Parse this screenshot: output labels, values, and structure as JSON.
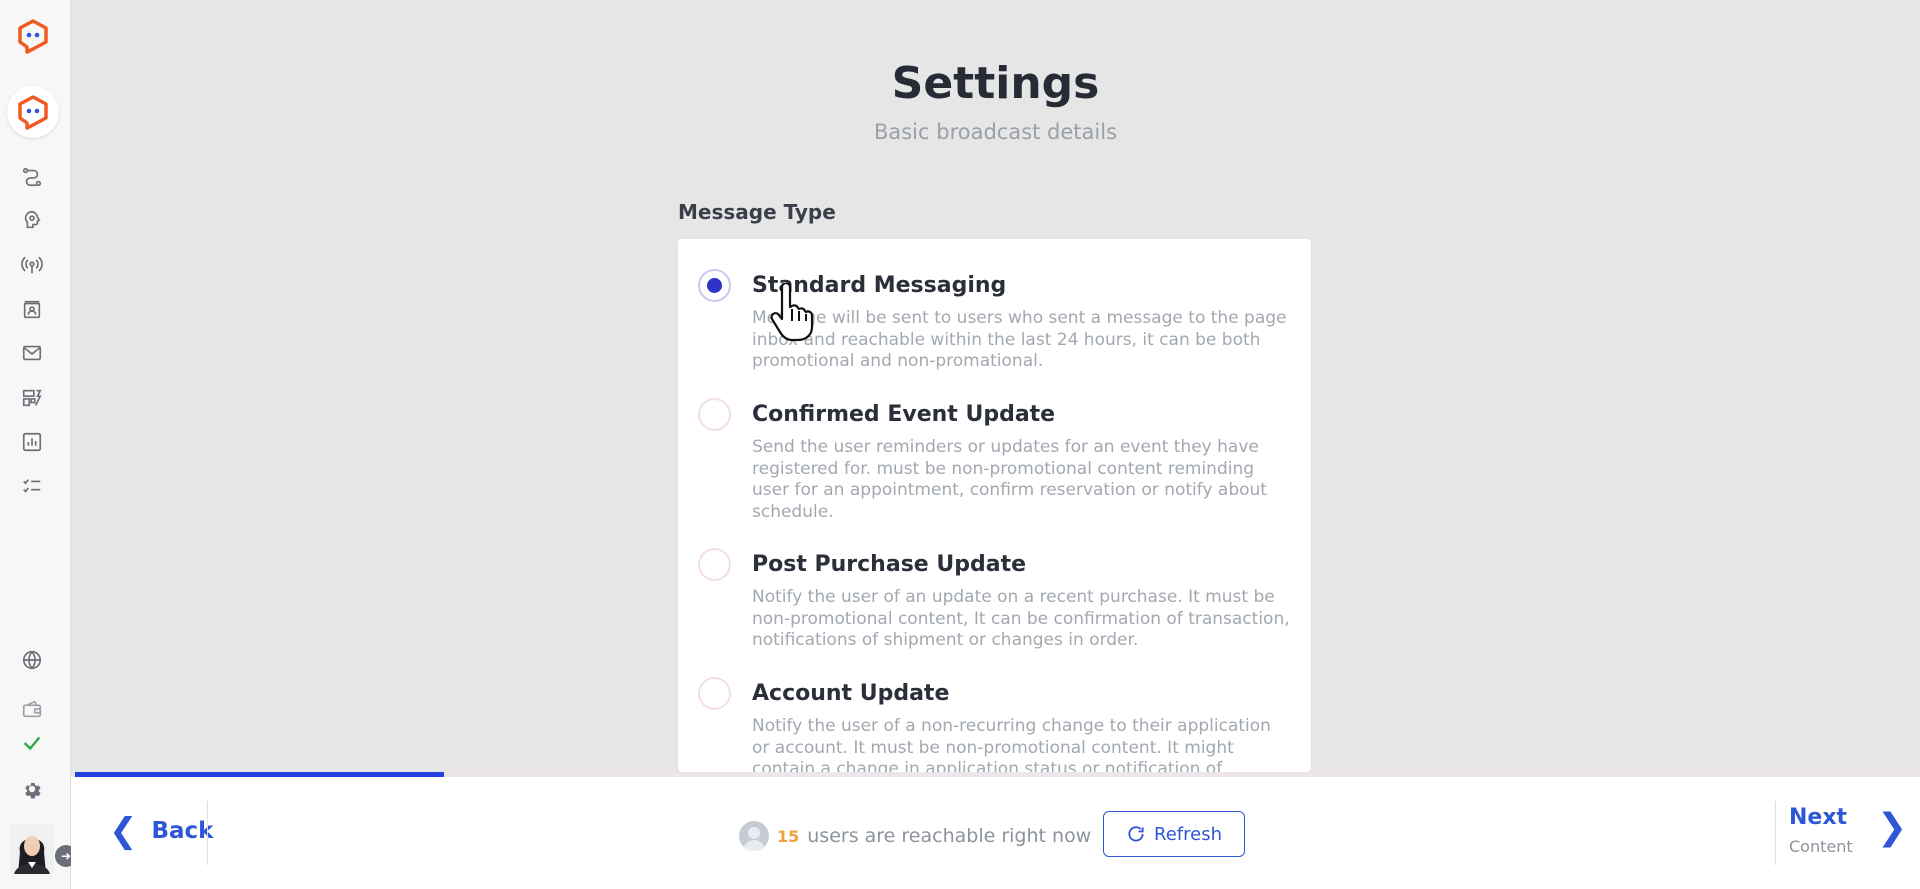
{
  "header": {
    "title": "Settings",
    "subtitle": "Basic broadcast details"
  },
  "message_type": {
    "label": "Message Type",
    "options": [
      {
        "title": "Standard Messaging",
        "description": "Message will be sent to users who sent a message to the page inbox and reachable within the last 24 hours, it can be both promotional and non-promational.",
        "selected": true
      },
      {
        "title": "Confirmed Event Update",
        "description": "Send the user reminders or updates for an event they have registered for. must be non-promotional content reminding user for an appointment, confirm reservation or notify about schedule.",
        "selected": false
      },
      {
        "title": "Post Purchase Update",
        "description": "Notify the user of an update on a recent purchase. It must be non-promotional content, It can be confirmation of transaction, notifications of shipment or changes in order.",
        "selected": false
      },
      {
        "title": "Account Update",
        "description": "Notify the user of a non-recurring change to their application or account. It must be non-promotional content. It might contain a change in application status or notification of",
        "selected": false
      }
    ]
  },
  "progress": {
    "fraction": 0.2
  },
  "footer": {
    "back_label": "Back",
    "reach_count": "15",
    "reach_text": "users are reachable right now",
    "refresh_label": "Refresh",
    "next_label": "Next",
    "next_sub": "Content"
  },
  "colors": {
    "accent": "#2f56d6",
    "radio_selected": "#2d33c9",
    "brand_orange": "#f05a22",
    "check_green": "#2aa84a"
  },
  "sidebar": {
    "icons": [
      "brand-logo-icon",
      "bot-avatar-icon",
      "flow-icon",
      "ai-brain-icon",
      "broadcast-icon",
      "contacts-icon",
      "mail-icon",
      "widgets-icon",
      "analytics-icon",
      "checklist-icon",
      "globe-icon",
      "wallet-icon",
      "check-icon",
      "gear-icon"
    ]
  }
}
